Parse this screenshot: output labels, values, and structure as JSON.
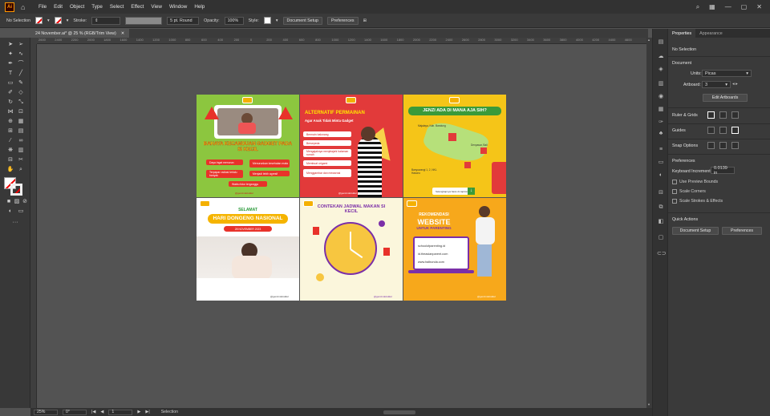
{
  "app": {
    "logo": "Ai",
    "window_controls": [
      "—",
      "▢",
      "✕"
    ]
  },
  "menu": [
    "File",
    "Edit",
    "Object",
    "Type",
    "Select",
    "Effect",
    "View",
    "Window",
    "Help"
  ],
  "control": {
    "selection": "No Selection",
    "stroke_label": "Stroke:",
    "brush": "5 pt. Round",
    "opacity_label": "Opacity:",
    "opacity": "100%",
    "style_label": "Style:",
    "doc_setup": "Document Setup",
    "preferences": "Preferences"
  },
  "doc_tab": {
    "title": "24 November.ai* @ 25 % (RGB/Trim View)",
    "close": "✕"
  },
  "ruler_ticks": [
    "2600",
    "2400",
    "2200",
    "2000",
    "1800",
    "1600",
    "1400",
    "1200",
    "1000",
    "800",
    "600",
    "400",
    "200",
    "0",
    "200",
    "400",
    "600",
    "800",
    "1000",
    "1200",
    "1400",
    "1600",
    "1800",
    "2000",
    "2200",
    "2400",
    "2600",
    "2800",
    "3000",
    "3200",
    "3400",
    "3600",
    "3800",
    "4000",
    "4200",
    "4400",
    "4600"
  ],
  "status": {
    "zoom": "25%",
    "rotate": "0°",
    "artboard": "1",
    "mode": "Selection"
  },
  "properties": {
    "tabs": [
      "Properties",
      "Appearance"
    ],
    "no_selection": "No Selection",
    "document": "Document",
    "units_label": "Units:",
    "units": "Picas",
    "artboard_label": "Artboard:",
    "artboard": "3",
    "edit_artboards": "Edit Artboards",
    "ruler_grids": "Ruler & Grids",
    "guides": "Guides",
    "snap_options": "Snap Options",
    "preferences": "Preferences",
    "keyboard_increment_label": "Keyboard Increment:",
    "keyboard_increment": "0.0139 in",
    "use_preview_bounds": "Use Preview Bounds",
    "scale_corners": "Scale Corners",
    "scale_strokes": "Scale Strokes & Effects",
    "quick_actions": "Quick Actions",
    "document_setup": "Document Setup",
    "preferences_btn": "Preferences"
  },
  "artboards": {
    "a1": {
      "title": "BAHAYA KECANDUAN GADGET PADA SI KECIL",
      "items": [
        "Daya ingat menurun",
        "Menurunkan kesehatan mata",
        "Terpapar radiasi terlalu banyak",
        "Menjadi lebih agresif",
        "Waktu tidur terganggu"
      ],
      "handle": "@gencindokulkul"
    },
    "a2": {
      "title": "ALTERNATIF PERMAINAN",
      "subtitle": "Agar Anak Tidak Minta Gadget",
      "items": [
        "Bermain balonang",
        "Bersepeda",
        "Mengajaknya menjelajahi halaman rumah",
        "Membuat origami",
        "Menggambar dan mewarnai"
      ],
      "handle": "@gencindokulkul"
    },
    "a3": {
      "title": "JENZI ADA DI MANA AJA SIH?",
      "labels": [
        "Majalaya, Kab. Bandung",
        "Denpasar, Bali",
        "Banyuwangi 1, 2, NKL Hasono",
        "Selengkapnya baca di caption ya"
      ]
    },
    "a4": {
      "title_top": "SELAMAT",
      "title": "HARI DONGENG NASIONAL",
      "date": "28 NOVEMBER 2023",
      "handle": "@gencindokulkul"
    },
    "a5": {
      "title": "CONTEKAN JADWAL MAKAN SI KECIL",
      "handle": "@gencindokulkul"
    },
    "a6": {
      "title_top": "REKOMENDASI",
      "title": "WEBSITE",
      "title_bottom": "UNTUK PARENTING",
      "sites": [
        "schoolofparenting.id",
        "id.theasianparent.com",
        "www.halbunda.com"
      ],
      "handle": "@gencindokulkul"
    }
  }
}
